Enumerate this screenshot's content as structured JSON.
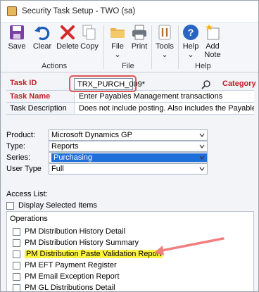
{
  "window": {
    "title": "Security Task Setup  -  TWO (sa)"
  },
  "ribbon": {
    "buttons": [
      {
        "label": "Save",
        "icon": "save-icon"
      },
      {
        "label": "Clear",
        "icon": "undo-icon"
      },
      {
        "label": "Delete",
        "icon": "delete-x-icon"
      },
      {
        "label": "Copy",
        "icon": "copy-icon"
      },
      {
        "label": "File",
        "icon": "folder-icon"
      },
      {
        "label": "Print",
        "icon": "printer-icon"
      },
      {
        "label": "Tools",
        "icon": "tools-icon"
      },
      {
        "label": "Help",
        "icon": "help-icon"
      },
      {
        "label": "Add",
        "label2": "Note",
        "icon": "add-note-icon"
      }
    ],
    "groups": [
      "Actions",
      "File",
      "Help"
    ]
  },
  "form": {
    "task_id_label": "Task ID",
    "task_id_value": "TRX_PURCH_009*",
    "category_label": "Category",
    "task_name_label": "Task Name",
    "task_name_value": "Enter Payables Management transactions",
    "task_desc_label": "Task Description",
    "task_desc_value": "Does not include posting. Also includes the Payables Transaction"
  },
  "selects": {
    "product_label": "Product:",
    "product_value": "Microsoft Dynamics GP",
    "type_label": "Type:",
    "type_value": "Reports",
    "series_label": "Series:",
    "series_value": "Purchasing",
    "usertype_label": "User Type",
    "usertype_value": "Full"
  },
  "access": {
    "label": "Access List:",
    "display_selected": "Display Selected Items",
    "header": "Operations",
    "items": [
      "PM Distribution History Detail",
      "PM Distribution History Summary",
      "PM Distribution Paste Validation Report",
      "PM EFT Payment Register",
      "PM Email Exception Report",
      "PM GL Distributions Detail"
    ]
  },
  "colors": {
    "accent_red": "#c0202a",
    "highlight_yellow": "#fbf33f",
    "arrow": "#f08080",
    "selection_blue": "#1e6fd9"
  }
}
